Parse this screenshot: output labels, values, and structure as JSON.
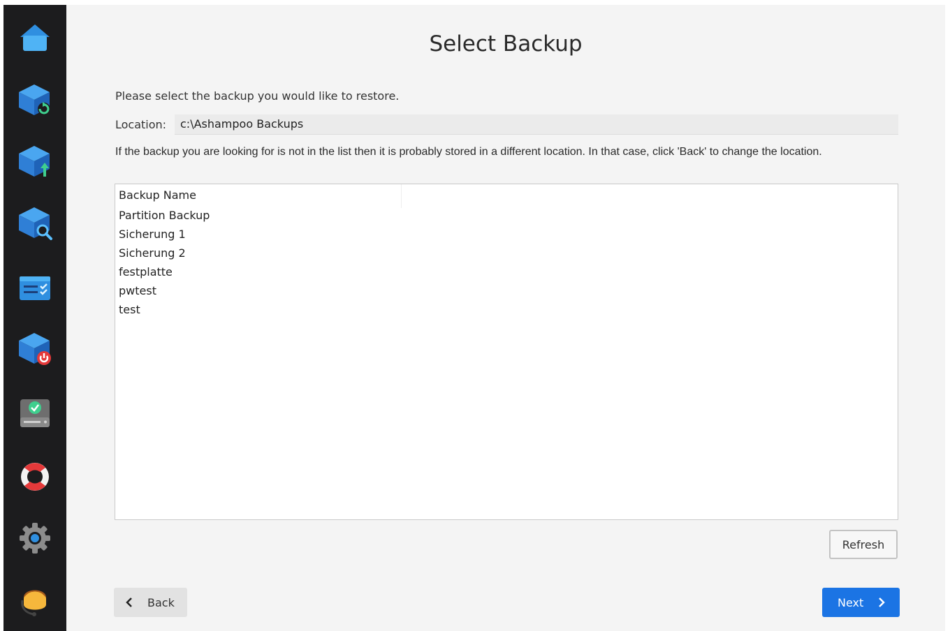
{
  "sidebar": {
    "items": [
      {
        "icon": "home-icon"
      },
      {
        "icon": "backup-refresh-icon"
      },
      {
        "icon": "backup-upload-icon"
      },
      {
        "icon": "backup-search-icon"
      },
      {
        "icon": "task-list-icon"
      },
      {
        "icon": "backup-power-icon"
      },
      {
        "icon": "drive-check-icon"
      },
      {
        "icon": "lifebuoy-icon"
      },
      {
        "icon": "gear-icon"
      },
      {
        "icon": "support-avatar-icon"
      }
    ],
    "accent_color": "#3a9ae8"
  },
  "main": {
    "title": "Select Backup",
    "instruction": "Please select the backup you would like to restore.",
    "location": {
      "label": "Location:",
      "value": "c:\\Ashampoo Backups"
    },
    "hint": "If the backup you are looking for is not in the list then it is probably stored in a different location. In that case, click 'Back' to change the location.",
    "list": {
      "column_header": "Backup Name",
      "rows": [
        "Partition Backup",
        "Sicherung 1",
        "Sicherung 2",
        "festplatte",
        "pwtest",
        "test"
      ]
    },
    "refresh_label": "Refresh",
    "back_label": "Back",
    "next_label": "Next",
    "next_color": "#1b74e4"
  }
}
